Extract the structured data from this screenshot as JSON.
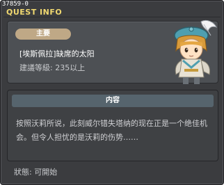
{
  "window": {
    "quest_id": "37859-0",
    "title": "QUEST INFO"
  },
  "info": {
    "badge_label": "主要",
    "quest_name": "[埃斯佩拉]缺席的太阳",
    "recommended_level": "建議等級: 235以上"
  },
  "content": {
    "header": "内容",
    "text": "按照沃莉所说，此刻威尔错失塔纳的现在正是一个绝佳机会。但令人担忧的是沃莉的伤势……"
  },
  "status": {
    "text": "狀態: 可開始"
  },
  "colors": {
    "window_bg": "#3b3c3f",
    "title_gold": "#f0d870",
    "badge": "#bfa886",
    "header_bar": "#56646d"
  }
}
